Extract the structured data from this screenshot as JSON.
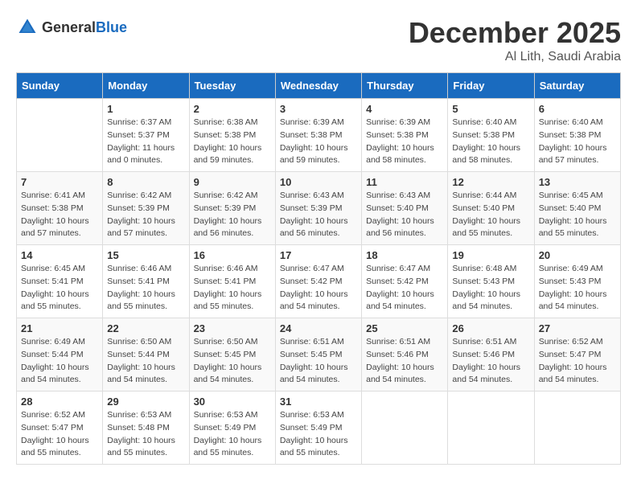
{
  "header": {
    "logo_general": "General",
    "logo_blue": "Blue",
    "month": "December 2025",
    "location": "Al Lith, Saudi Arabia"
  },
  "weekdays": [
    "Sunday",
    "Monday",
    "Tuesday",
    "Wednesday",
    "Thursday",
    "Friday",
    "Saturday"
  ],
  "weeks": [
    [
      {
        "day": "",
        "sunrise": "",
        "sunset": "",
        "daylight": ""
      },
      {
        "day": "1",
        "sunrise": "Sunrise: 6:37 AM",
        "sunset": "Sunset: 5:37 PM",
        "daylight": "Daylight: 11 hours and 0 minutes."
      },
      {
        "day": "2",
        "sunrise": "Sunrise: 6:38 AM",
        "sunset": "Sunset: 5:38 PM",
        "daylight": "Daylight: 10 hours and 59 minutes."
      },
      {
        "day": "3",
        "sunrise": "Sunrise: 6:39 AM",
        "sunset": "Sunset: 5:38 PM",
        "daylight": "Daylight: 10 hours and 59 minutes."
      },
      {
        "day": "4",
        "sunrise": "Sunrise: 6:39 AM",
        "sunset": "Sunset: 5:38 PM",
        "daylight": "Daylight: 10 hours and 58 minutes."
      },
      {
        "day": "5",
        "sunrise": "Sunrise: 6:40 AM",
        "sunset": "Sunset: 5:38 PM",
        "daylight": "Daylight: 10 hours and 58 minutes."
      },
      {
        "day": "6",
        "sunrise": "Sunrise: 6:40 AM",
        "sunset": "Sunset: 5:38 PM",
        "daylight": "Daylight: 10 hours and 57 minutes."
      }
    ],
    [
      {
        "day": "7",
        "sunrise": "Sunrise: 6:41 AM",
        "sunset": "Sunset: 5:38 PM",
        "daylight": "Daylight: 10 hours and 57 minutes."
      },
      {
        "day": "8",
        "sunrise": "Sunrise: 6:42 AM",
        "sunset": "Sunset: 5:39 PM",
        "daylight": "Daylight: 10 hours and 57 minutes."
      },
      {
        "day": "9",
        "sunrise": "Sunrise: 6:42 AM",
        "sunset": "Sunset: 5:39 PM",
        "daylight": "Daylight: 10 hours and 56 minutes."
      },
      {
        "day": "10",
        "sunrise": "Sunrise: 6:43 AM",
        "sunset": "Sunset: 5:39 PM",
        "daylight": "Daylight: 10 hours and 56 minutes."
      },
      {
        "day": "11",
        "sunrise": "Sunrise: 6:43 AM",
        "sunset": "Sunset: 5:40 PM",
        "daylight": "Daylight: 10 hours and 56 minutes."
      },
      {
        "day": "12",
        "sunrise": "Sunrise: 6:44 AM",
        "sunset": "Sunset: 5:40 PM",
        "daylight": "Daylight: 10 hours and 55 minutes."
      },
      {
        "day": "13",
        "sunrise": "Sunrise: 6:45 AM",
        "sunset": "Sunset: 5:40 PM",
        "daylight": "Daylight: 10 hours and 55 minutes."
      }
    ],
    [
      {
        "day": "14",
        "sunrise": "Sunrise: 6:45 AM",
        "sunset": "Sunset: 5:41 PM",
        "daylight": "Daylight: 10 hours and 55 minutes."
      },
      {
        "day": "15",
        "sunrise": "Sunrise: 6:46 AM",
        "sunset": "Sunset: 5:41 PM",
        "daylight": "Daylight: 10 hours and 55 minutes."
      },
      {
        "day": "16",
        "sunrise": "Sunrise: 6:46 AM",
        "sunset": "Sunset: 5:41 PM",
        "daylight": "Daylight: 10 hours and 55 minutes."
      },
      {
        "day": "17",
        "sunrise": "Sunrise: 6:47 AM",
        "sunset": "Sunset: 5:42 PM",
        "daylight": "Daylight: 10 hours and 54 minutes."
      },
      {
        "day": "18",
        "sunrise": "Sunrise: 6:47 AM",
        "sunset": "Sunset: 5:42 PM",
        "daylight": "Daylight: 10 hours and 54 minutes."
      },
      {
        "day": "19",
        "sunrise": "Sunrise: 6:48 AM",
        "sunset": "Sunset: 5:43 PM",
        "daylight": "Daylight: 10 hours and 54 minutes."
      },
      {
        "day": "20",
        "sunrise": "Sunrise: 6:49 AM",
        "sunset": "Sunset: 5:43 PM",
        "daylight": "Daylight: 10 hours and 54 minutes."
      }
    ],
    [
      {
        "day": "21",
        "sunrise": "Sunrise: 6:49 AM",
        "sunset": "Sunset: 5:44 PM",
        "daylight": "Daylight: 10 hours and 54 minutes."
      },
      {
        "day": "22",
        "sunrise": "Sunrise: 6:50 AM",
        "sunset": "Sunset: 5:44 PM",
        "daylight": "Daylight: 10 hours and 54 minutes."
      },
      {
        "day": "23",
        "sunrise": "Sunrise: 6:50 AM",
        "sunset": "Sunset: 5:45 PM",
        "daylight": "Daylight: 10 hours and 54 minutes."
      },
      {
        "day": "24",
        "sunrise": "Sunrise: 6:51 AM",
        "sunset": "Sunset: 5:45 PM",
        "daylight": "Daylight: 10 hours and 54 minutes."
      },
      {
        "day": "25",
        "sunrise": "Sunrise: 6:51 AM",
        "sunset": "Sunset: 5:46 PM",
        "daylight": "Daylight: 10 hours and 54 minutes."
      },
      {
        "day": "26",
        "sunrise": "Sunrise: 6:51 AM",
        "sunset": "Sunset: 5:46 PM",
        "daylight": "Daylight: 10 hours and 54 minutes."
      },
      {
        "day": "27",
        "sunrise": "Sunrise: 6:52 AM",
        "sunset": "Sunset: 5:47 PM",
        "daylight": "Daylight: 10 hours and 54 minutes."
      }
    ],
    [
      {
        "day": "28",
        "sunrise": "Sunrise: 6:52 AM",
        "sunset": "Sunset: 5:47 PM",
        "daylight": "Daylight: 10 hours and 55 minutes."
      },
      {
        "day": "29",
        "sunrise": "Sunrise: 6:53 AM",
        "sunset": "Sunset: 5:48 PM",
        "daylight": "Daylight: 10 hours and 55 minutes."
      },
      {
        "day": "30",
        "sunrise": "Sunrise: 6:53 AM",
        "sunset": "Sunset: 5:49 PM",
        "daylight": "Daylight: 10 hours and 55 minutes."
      },
      {
        "day": "31",
        "sunrise": "Sunrise: 6:53 AM",
        "sunset": "Sunset: 5:49 PM",
        "daylight": "Daylight: 10 hours and 55 minutes."
      },
      {
        "day": "",
        "sunrise": "",
        "sunset": "",
        "daylight": ""
      },
      {
        "day": "",
        "sunrise": "",
        "sunset": "",
        "daylight": ""
      },
      {
        "day": "",
        "sunrise": "",
        "sunset": "",
        "daylight": ""
      }
    ]
  ]
}
